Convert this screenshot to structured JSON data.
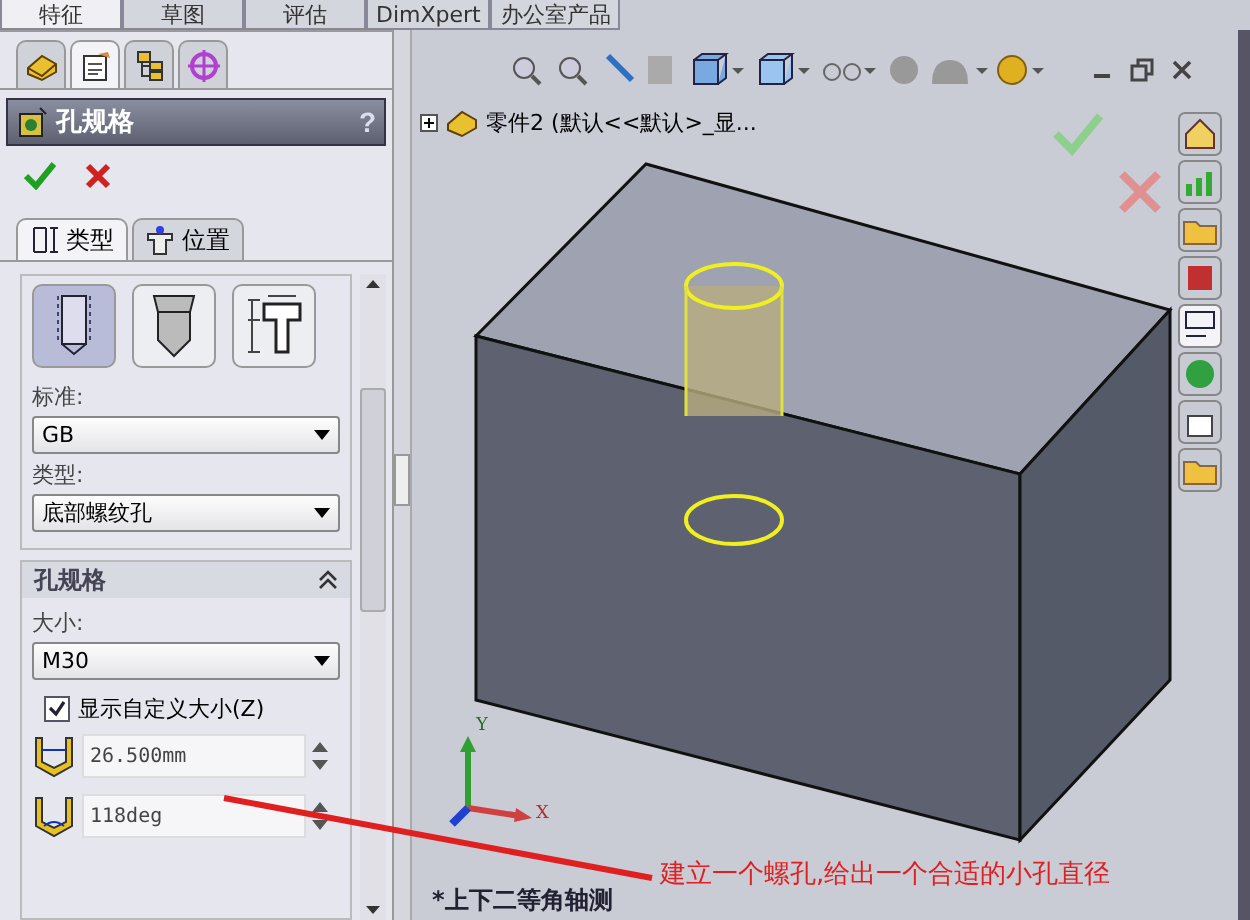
{
  "command_tabs": [
    {
      "label": "特征",
      "selected": true
    },
    {
      "label": "草图",
      "selected": false
    },
    {
      "label": "评估",
      "selected": false
    },
    {
      "label": "DimXpert",
      "selected": false
    },
    {
      "label": "办公室产品",
      "selected": false
    }
  ],
  "manager_tabs": [
    {
      "kind": "feature-tree",
      "selected": false
    },
    {
      "kind": "property",
      "selected": true
    },
    {
      "kind": "config",
      "selected": false
    },
    {
      "kind": "target",
      "selected": false
    }
  ],
  "property_manager": {
    "title": "孔规格",
    "help": "?"
  },
  "type_tabs": [
    {
      "kind": "type",
      "label": "类型",
      "selected": true
    },
    {
      "kind": "position",
      "label": "位置",
      "selected": false
    }
  ],
  "hole_types": [
    {
      "kind": "hole",
      "selected": true
    },
    {
      "kind": "tap",
      "selected": false
    },
    {
      "kind": "counterbore",
      "selected": false
    }
  ],
  "standard": {
    "label": "标准:",
    "value": "GB"
  },
  "type": {
    "label": "类型:",
    "value": "底部螺纹孔"
  },
  "spec_section": {
    "title": "孔规格",
    "expanded": true
  },
  "size": {
    "label": "大小:",
    "value": "M30"
  },
  "custom_size": {
    "label": "显示自定义大小(Z)",
    "checked": true
  },
  "spinners": [
    {
      "kind": "diameter",
      "value": "26.500mm"
    },
    {
      "kind": "angle",
      "value": "118deg"
    }
  ],
  "tree_item": {
    "label": "零件2 (默认<<默认>_显..."
  },
  "axes": {
    "x": "X",
    "y": "Y"
  },
  "view_label": "*上下二等角轴测",
  "annotation": "建立一个螺孔,给出一个合适的小孔直径"
}
